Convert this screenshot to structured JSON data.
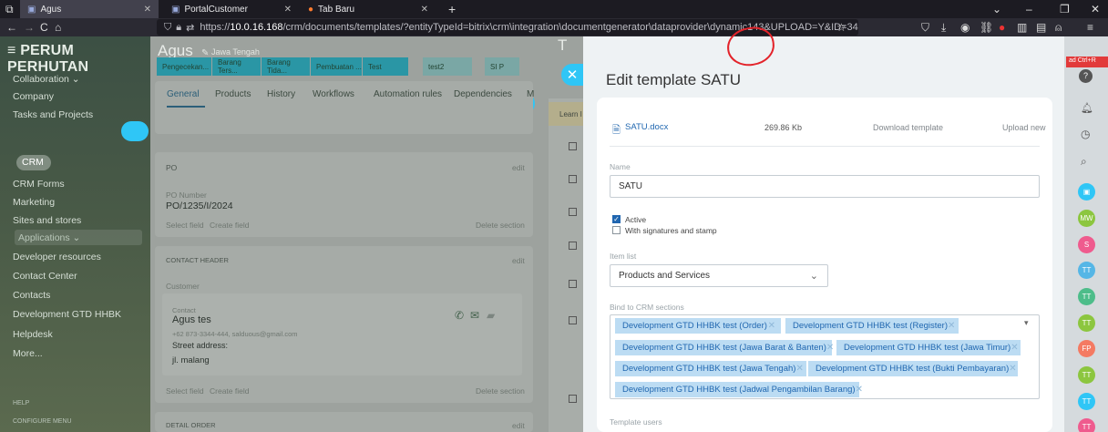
{
  "browser": {
    "tabs": [
      {
        "label": "Agus",
        "active": true
      },
      {
        "label": "PortalCustomer",
        "active": false
      },
      {
        "label": "Tab Baru",
        "active": false
      }
    ],
    "url_prefix": "https://",
    "url_host": "10.0.16.168",
    "url_path": "/crm/documents/templates/?entityTypeId=bitrix\\crm\\integration\\documentgenerator\\dataprovider\\dynamic143&UPLOAD=Y&ID=34"
  },
  "sidebar": {
    "brand": "PERUM PERHUTAN",
    "items": [
      "Collaboration ⌄",
      "Company",
      "Tasks and Projects",
      "CRM",
      "CRM Forms",
      "Marketing",
      "Sites and stores",
      "Applications ⌄",
      "Developer resources",
      "Contact Center",
      "Contacts",
      "Development GTD HHBK",
      "Helpdesk",
      "More..."
    ],
    "help": "HELP",
    "configure": "CONFIGURE MENU"
  },
  "background": {
    "title": "Agus",
    "subtitle": "Jawa Tengah",
    "stages": [
      "Pengecekan...",
      "Barang Ters...",
      "Barang Tida...",
      "Pembuatan ...",
      "Test",
      "test2",
      "SI P"
    ],
    "tabs": [
      "General",
      "Products",
      "History",
      "Workflows",
      "Automation rules",
      "Dependencies",
      "M"
    ],
    "po_header": "PO",
    "edit": "edit",
    "po_number_label": "PO Number",
    "po_number": "PO/1235/I/2024",
    "select_field": "Select field",
    "create_field": "Create field",
    "delete_section": "Delete section",
    "contact_header": "CONTACT HEADER",
    "customer_label": "Customer",
    "contact_label": "Contact",
    "contact_name": "Agus tes",
    "contact_phone": "+62 873-3344-444, salduous@gmail.com",
    "street_label": "Street address:",
    "street": "jl. malang",
    "detail_order": "DETAIL ORDER",
    "learn": "Learn I"
  },
  "panel": {
    "title": "Edit template SATU",
    "file_name": "SATU.docx",
    "file_size": "269.86 Kb",
    "download": "Download template",
    "upload_new": "Upload new",
    "name_label": "Name",
    "name_value": "SATU",
    "active_label": "Active",
    "active_checked": true,
    "signatures_label": "With signatures and stamp",
    "signatures_checked": false,
    "item_list_label": "Item list",
    "item_list_value": "Products and Services",
    "bind_label": "Bind to CRM sections",
    "sections": [
      "Development GTD HHBK test (Order)",
      "Development GTD HHBK test (Register)",
      "Development GTD HHBK test (Jawa Barat & Banten)",
      "Development GTD HHBK test (Jawa Timur)",
      "Development GTD HHBK test (Jawa Tengah)",
      "Development GTD HHBK test (Bukti Pembayaran)",
      "Development GTD HHBK test (Jadwal Pengambilan Barang)"
    ],
    "template_users_label": "Template users"
  },
  "rail": {
    "reload_hint": "ad Ctrl+R",
    "avatars": [
      "MW",
      "S",
      "TT",
      "TT",
      "TT",
      "FP",
      "TT",
      "TT",
      "TT"
    ],
    "avatar_colors": [
      "#8cc63f",
      "#ef5b8e",
      "#55b6e6",
      "#4dbd8a",
      "#8cc63f",
      "#f47a62",
      "#8cc63f",
      "#2fc6f6",
      "#ef5b8e"
    ]
  },
  "colors": {
    "accent": "#2fc6f6",
    "chip_bg": "#bcdcf3",
    "chip_text": "#2067b0",
    "annotation": "#e3232a"
  }
}
